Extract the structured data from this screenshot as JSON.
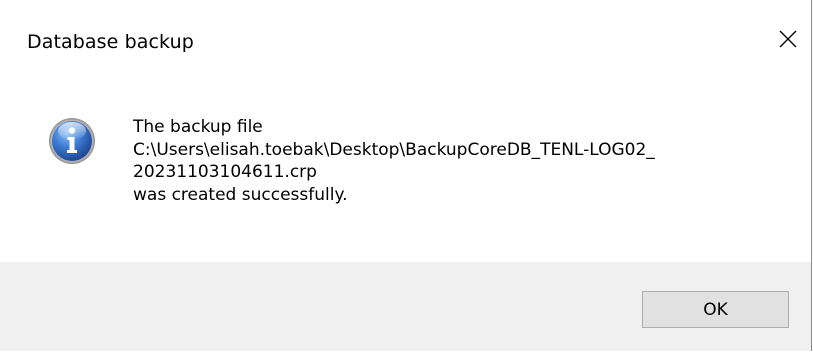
{
  "dialog": {
    "title": "Database backup",
    "close_icon": "close-icon",
    "icon": "information-icon",
    "message_lines": [
      "The backup file",
      "C:\\Users\\elisah.toebak\\Desktop\\BackupCoreDB_TENL-LOG02_",
      "20231103104611.crp",
      "was created successfully."
    ],
    "ok_label": "OK"
  },
  "colors": {
    "info_icon_blue": "#2a5fb5",
    "footer_bg": "#f0f0f0",
    "button_bg": "#e1e1e1",
    "button_border": "#adadad"
  }
}
